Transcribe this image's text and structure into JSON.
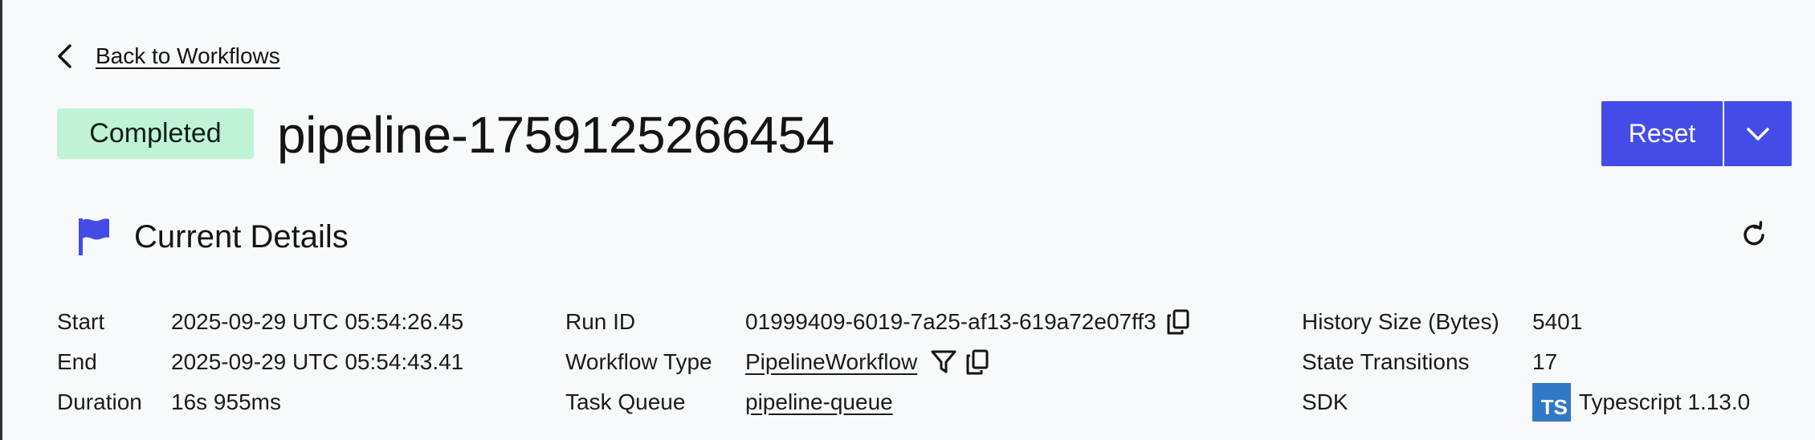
{
  "nav": {
    "back_label": "Back to Workflows",
    "back_icon": "chevron-left-icon"
  },
  "header": {
    "status": "Completed",
    "workflow_id": "pipeline-1759125266454",
    "reset_label": "Reset",
    "colors": {
      "status_bg": "#bff3d6",
      "primary": "#444ce7"
    }
  },
  "section": {
    "title": "Current Details",
    "icon": "flag-icon",
    "refresh_icon": "refresh-icon"
  },
  "details": {
    "start": {
      "label": "Start",
      "value": "2025-09-29 UTC 05:54:26.45"
    },
    "end": {
      "label": "End",
      "value": "2025-09-29 UTC 05:54:43.41"
    },
    "duration": {
      "label": "Duration",
      "value": "16s 955ms"
    },
    "run_id": {
      "label": "Run ID",
      "value": "01999409-6019-7a25-af13-619a72e07ff3"
    },
    "workflow_type": {
      "label": "Workflow Type",
      "value": "PipelineWorkflow"
    },
    "task_queue": {
      "label": "Task Queue",
      "value": "pipeline-queue"
    },
    "history_size": {
      "label": "History Size (Bytes)",
      "value": "5401"
    },
    "state_transitions": {
      "label": "State Transitions",
      "value": "17"
    },
    "sdk": {
      "label": "SDK",
      "badge": "TS",
      "value": "Typescript 1.13.0"
    }
  }
}
